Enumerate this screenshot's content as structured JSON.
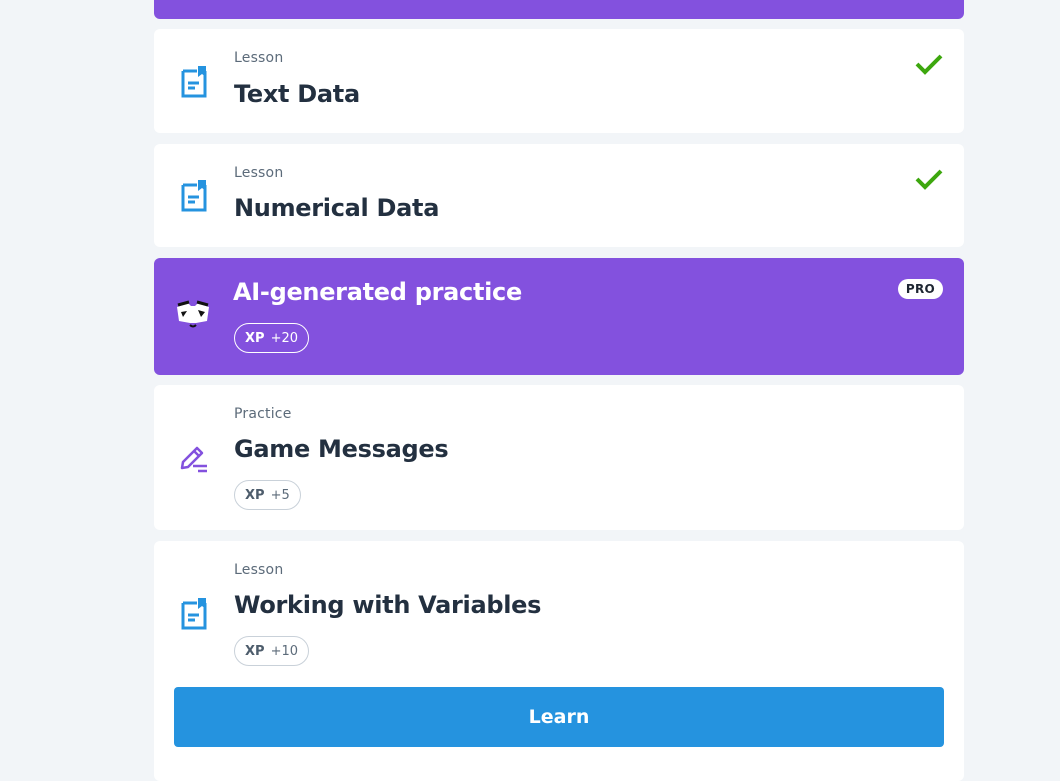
{
  "lessons": [
    {
      "kicker": "Lesson",
      "title": "Text Data",
      "completed": true
    },
    {
      "kicker": "Lesson",
      "title": "Numerical Data",
      "completed": true
    }
  ],
  "ai_practice": {
    "title": "AI-generated practice",
    "badge": "PRO",
    "xp_label": "XP",
    "xp_value": "+20"
  },
  "practice": {
    "kicker": "Practice",
    "title": "Game Messages",
    "xp_label": "XP",
    "xp_value": "+5"
  },
  "current_lesson": {
    "kicker": "Lesson",
    "title": "Working with Variables",
    "xp_label": "XP",
    "xp_value": "+10",
    "button_label": "Learn"
  },
  "colors": {
    "accent_purple": "#8351de",
    "lesson_icon_blue": "#2593df",
    "check_green": "#3da70e",
    "learn_button": "#2593df"
  },
  "icons": {
    "lesson": "document-bookmark-icon",
    "ai": "ai-mascot-face-icon",
    "practice": "pencil-edit-icon",
    "done": "check-icon"
  }
}
